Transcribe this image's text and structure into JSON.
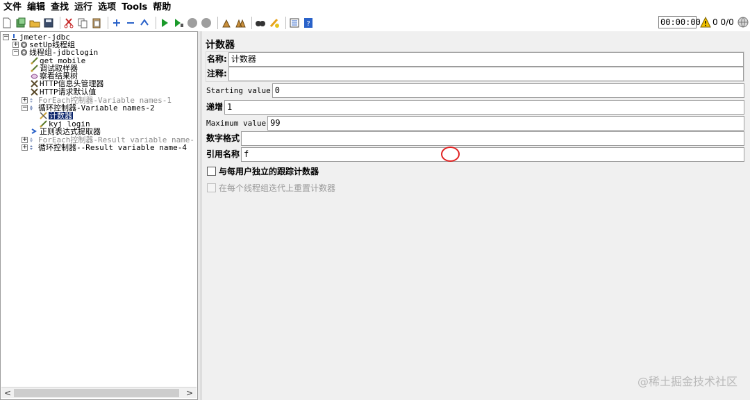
{
  "menu": [
    "文件",
    "编辑",
    "查找",
    "运行",
    "选项",
    "Tools",
    "帮助"
  ],
  "toolbar": {
    "icons": [
      "new-icon",
      "templates-icon",
      "open-icon",
      "save-icon",
      "cut-icon",
      "copy-icon",
      "paste-icon",
      "expand-icon",
      "collapse-icon",
      "toggle-icon",
      "start-icon",
      "start-no-pause-icon",
      "stop-icon",
      "shutdown-icon",
      "clear-icon",
      "clear-all-icon",
      "search-icon",
      "reset-search-icon",
      "function-helper-icon",
      "help-icon"
    ],
    "timer": "00:00:00",
    "warn_count": "0",
    "threads": "0/0"
  },
  "tree": [
    {
      "label": "jmeter-jdbc",
      "icon": "testplan-icon",
      "style": "normal"
    },
    {
      "label": "setUp线程组",
      "icon": "gear-icon",
      "style": "normal"
    },
    {
      "label": "线程组-jdbclogin",
      "icon": "gear-icon",
      "style": "normal"
    },
    {
      "label": "get mobile",
      "icon": "sampler-icon",
      "style": "normal"
    },
    {
      "label": "调试取样器",
      "icon": "sampler-icon",
      "style": "normal"
    },
    {
      "label": "察看结果树",
      "icon": "listener-icon",
      "style": "normal"
    },
    {
      "label": "HTTP信息头管理器",
      "icon": "config-icon",
      "style": "normal"
    },
    {
      "label": "HTTP请求默认值",
      "icon": "config-icon",
      "style": "normal"
    },
    {
      "label": "ForEach控制器-Variable names-1",
      "icon": "controller-icon",
      "style": "gray"
    },
    {
      "label": "循环控制器-Variable names-2",
      "icon": "controller-icon",
      "style": "normal"
    },
    {
      "label": "计数器",
      "icon": "counter-icon",
      "style": "selected"
    },
    {
      "label": "kyj login",
      "icon": "sampler-icon",
      "style": "normal"
    },
    {
      "label": "正则表达式提取器",
      "icon": "extractor-icon",
      "style": "normal"
    },
    {
      "label": "ForEach控制器-Result variable name-",
      "icon": "controller-icon",
      "style": "gray"
    },
    {
      "label": "循环控制器--Result variable name-4",
      "icon": "controller-icon",
      "style": "normal"
    }
  ],
  "panel": {
    "title": "计数器",
    "name_label": "名称:",
    "name_value": "计数器",
    "comment_label": "注释:",
    "comment_value": "",
    "start_label": "Starting value",
    "start_value": "0",
    "incr_label": "递增",
    "incr_value": "1",
    "max_label": "Maximum value",
    "max_value": "99",
    "format_label": "数字格式",
    "format_value": "",
    "ref_label": "引用名称",
    "ref_value": "f",
    "per_user_label": "与每用户独立的跟踪计数器",
    "reset_label": "在每个线程组迭代上重置计数器"
  },
  "watermark": "@稀土掘金技术社区"
}
